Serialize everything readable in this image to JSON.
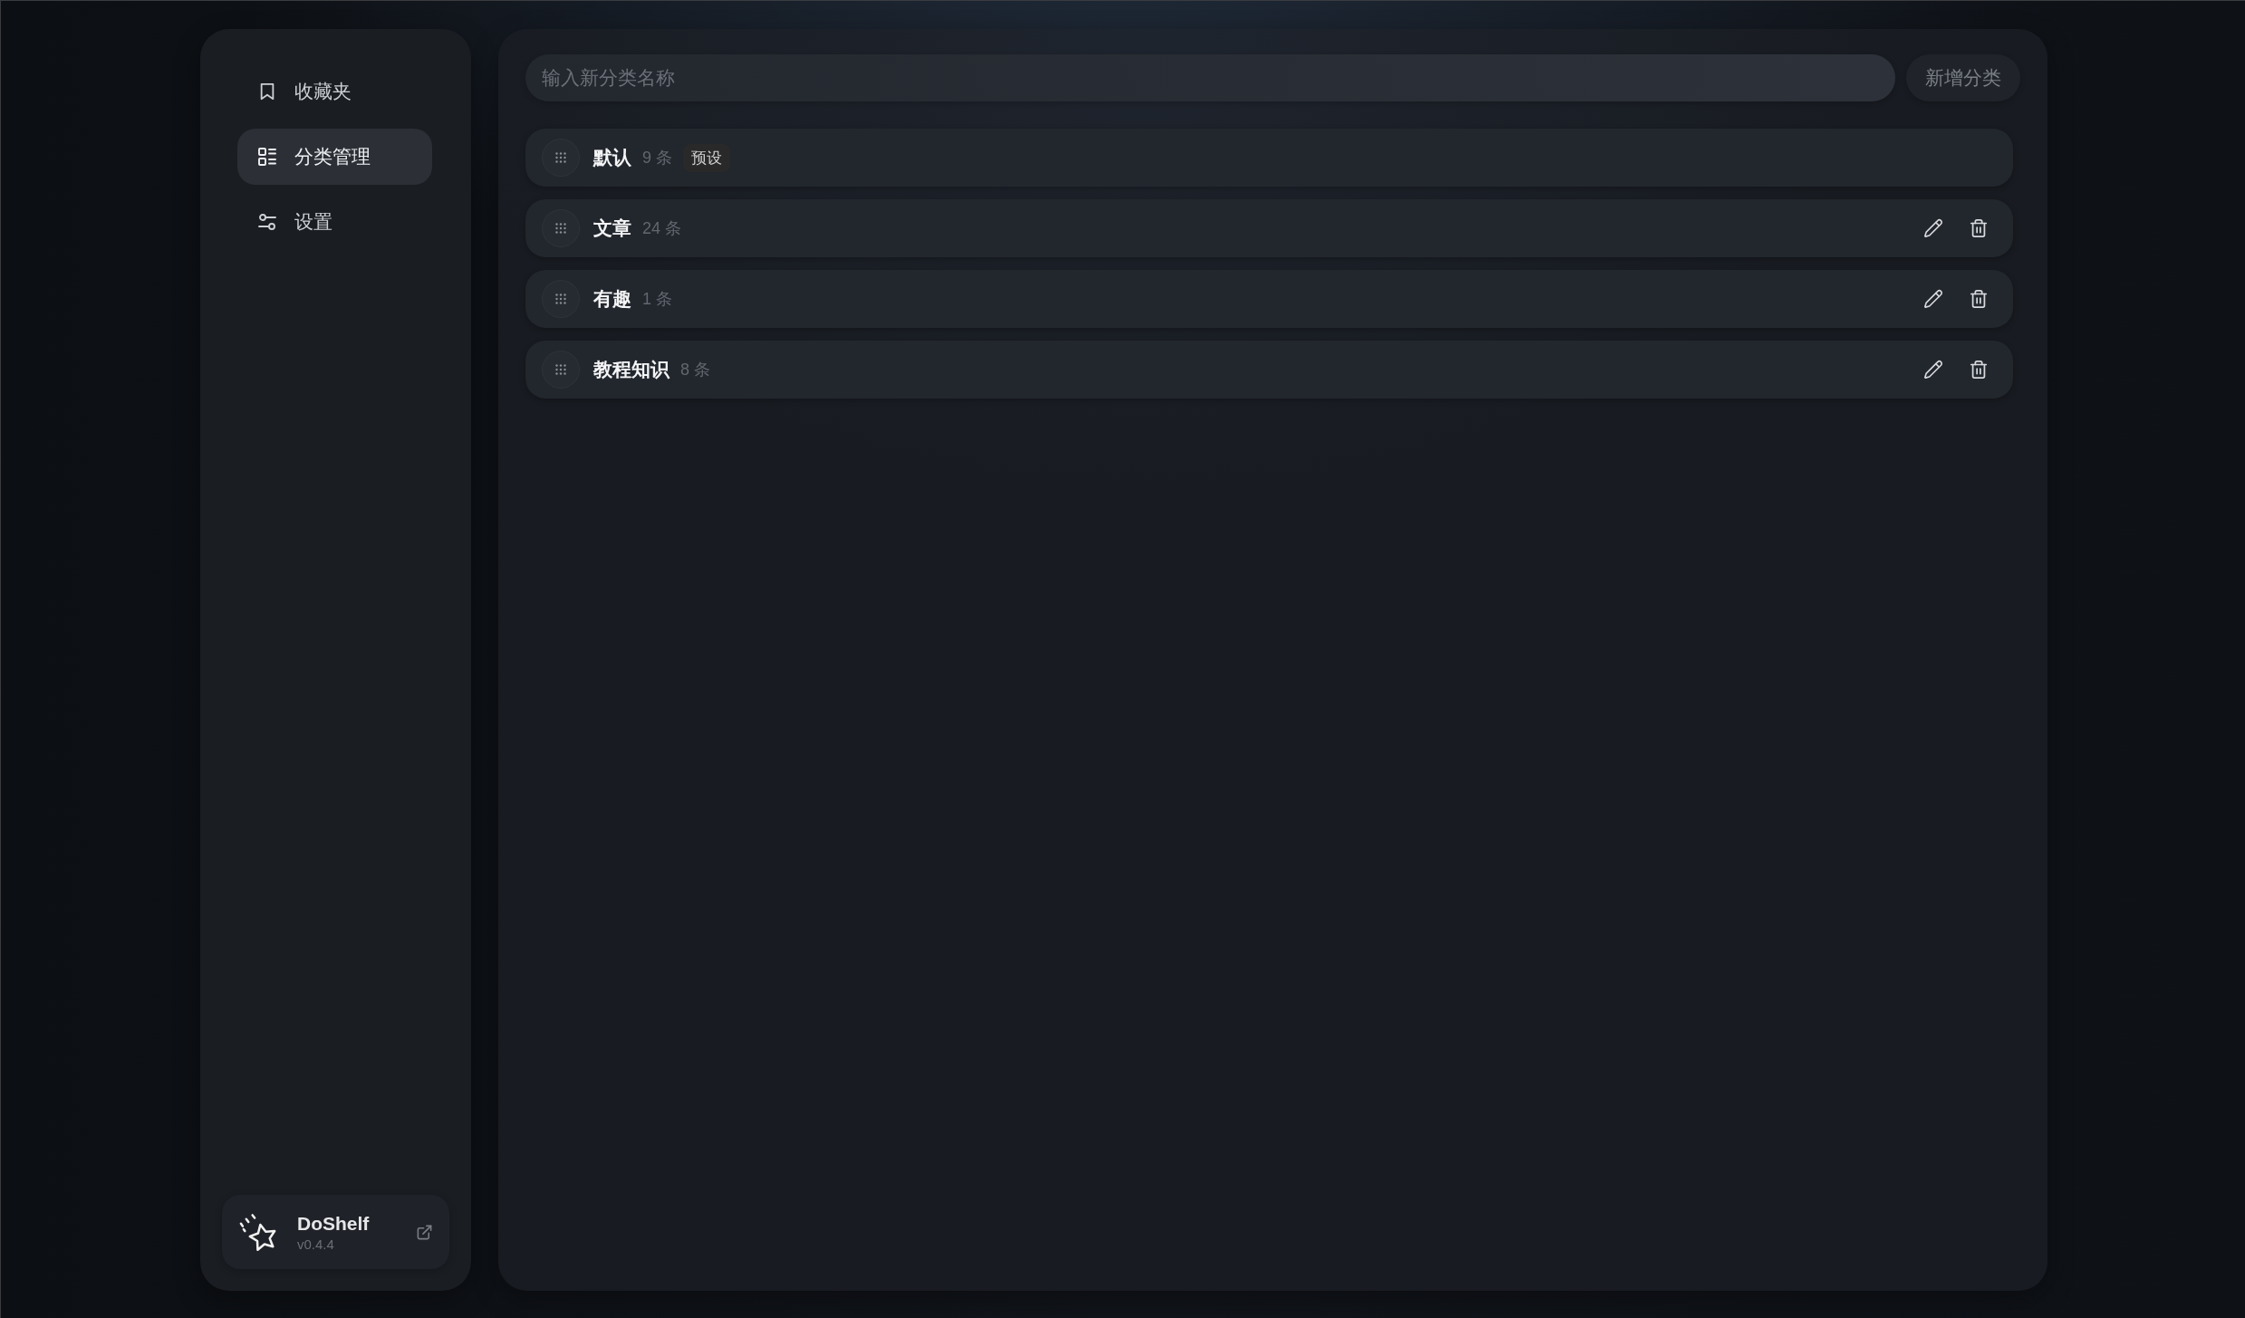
{
  "sidebar": {
    "nav_items": [
      {
        "label": "收藏夹",
        "selected": false
      },
      {
        "label": "分类管理",
        "selected": true
      },
      {
        "label": "设置",
        "selected": false
      }
    ],
    "app_card": {
      "name": "DoShelf",
      "version": "v0.4.4"
    }
  },
  "new_category": {
    "placeholder": "输入新分类名称",
    "button": "新增分类"
  },
  "categories": [
    {
      "name": "默认",
      "count": "9 条",
      "badge": "预设",
      "editable": false
    },
    {
      "name": "文章",
      "count": "24 条",
      "editable": true
    },
    {
      "name": "有趣",
      "count": "1 条",
      "editable": true
    },
    {
      "name": "教程知识",
      "count": "8 条",
      "editable": true
    }
  ]
}
